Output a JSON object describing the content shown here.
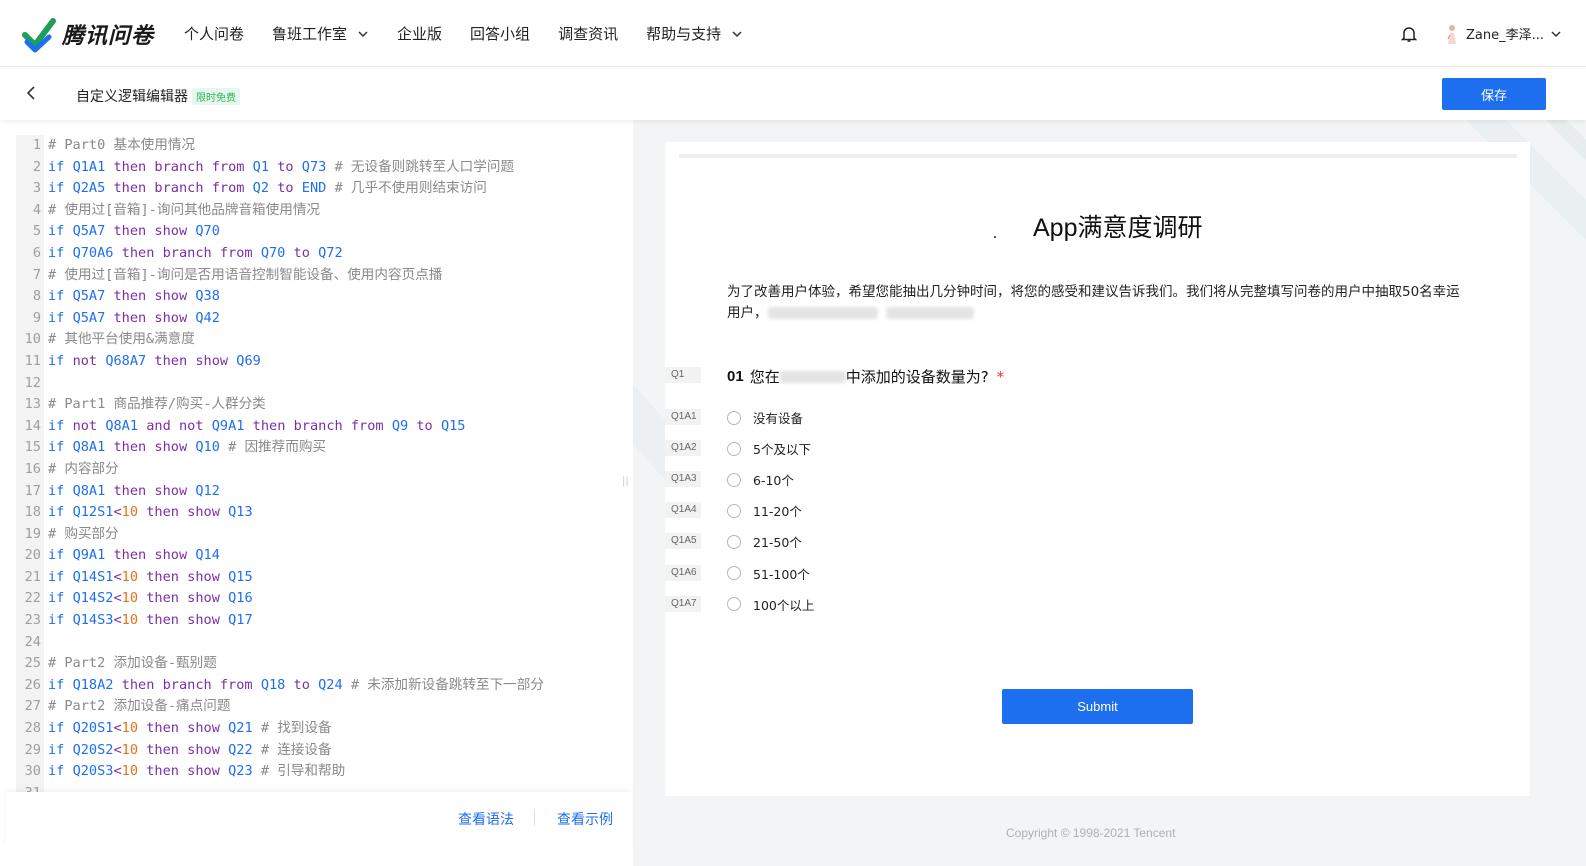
{
  "nav": {
    "brand": "腾讯问卷",
    "items": [
      "个人问卷",
      "鲁班工作室",
      "企业版",
      "回答小组",
      "调查资讯",
      "帮助与支持"
    ],
    "user": "Zane_李泽..."
  },
  "subheader": {
    "title": "自定义逻辑编辑器",
    "badge": "限时免费",
    "save_label": "保存"
  },
  "editor": {
    "lines": [
      {
        "n": "1",
        "tokens": [
          [
            "cm",
            "# Part0 基本使用情况"
          ]
        ]
      },
      {
        "n": "2",
        "tokens": [
          [
            "kw",
            "if "
          ],
          [
            "id",
            "Q1A1"
          ],
          [
            "kw2",
            " then branch from "
          ],
          [
            "id",
            "Q1"
          ],
          [
            "kw2",
            " to "
          ],
          [
            "id",
            "Q73"
          ],
          [
            "cm",
            " # 无设备则跳转至人口学问题"
          ]
        ]
      },
      {
        "n": "3",
        "tokens": [
          [
            "kw",
            "if "
          ],
          [
            "id",
            "Q2A5"
          ],
          [
            "kw2",
            " then branch from "
          ],
          [
            "id",
            "Q2"
          ],
          [
            "kw2",
            " to "
          ],
          [
            "id",
            "END"
          ],
          [
            "cm",
            " # 几乎不使用则结束访问"
          ]
        ]
      },
      {
        "n": "4",
        "tokens": [
          [
            "cm",
            "# 使用过[音箱]-询问其他品牌音箱使用情况"
          ]
        ]
      },
      {
        "n": "5",
        "tokens": [
          [
            "kw",
            "if "
          ],
          [
            "id",
            "Q5A7"
          ],
          [
            "kw2",
            " then show "
          ],
          [
            "id",
            "Q70"
          ]
        ]
      },
      {
        "n": "6",
        "tokens": [
          [
            "kw",
            "if "
          ],
          [
            "id",
            "Q70A6"
          ],
          [
            "kw2",
            " then branch from "
          ],
          [
            "id",
            "Q70"
          ],
          [
            "kw2",
            " to "
          ],
          [
            "id",
            "Q72"
          ]
        ]
      },
      {
        "n": "7",
        "tokens": [
          [
            "cm",
            "# 使用过[音箱]-询问是否用语音控制智能设备、使用内容页点播"
          ]
        ]
      },
      {
        "n": "8",
        "tokens": [
          [
            "kw",
            "if "
          ],
          [
            "id",
            "Q5A7"
          ],
          [
            "kw2",
            " then show "
          ],
          [
            "id",
            "Q38"
          ]
        ]
      },
      {
        "n": "9",
        "tokens": [
          [
            "kw",
            "if "
          ],
          [
            "id",
            "Q5A7"
          ],
          [
            "kw2",
            " then show "
          ],
          [
            "id",
            "Q42"
          ]
        ]
      },
      {
        "n": "10",
        "tokens": [
          [
            "cm",
            "# 其他平台使用&满意度"
          ]
        ]
      },
      {
        "n": "11",
        "tokens": [
          [
            "kw",
            "if "
          ],
          [
            "kw2",
            "not "
          ],
          [
            "id",
            "Q68A7"
          ],
          [
            "kw2",
            " then show "
          ],
          [
            "id",
            "Q69"
          ]
        ]
      },
      {
        "n": "12",
        "tokens": []
      },
      {
        "n": "13",
        "tokens": [
          [
            "cm",
            "# Part1 商品推荐/购买-人群分类"
          ]
        ]
      },
      {
        "n": "14",
        "tokens": [
          [
            "kw",
            "if "
          ],
          [
            "kw2",
            "not "
          ],
          [
            "id",
            "Q8A1"
          ],
          [
            "kw2",
            " and not "
          ],
          [
            "id",
            "Q9A1"
          ],
          [
            "kw2",
            " then branch from "
          ],
          [
            "id",
            "Q9"
          ],
          [
            "kw2",
            " to "
          ],
          [
            "id",
            "Q15"
          ]
        ]
      },
      {
        "n": "15",
        "tokens": [
          [
            "kw",
            "if "
          ],
          [
            "id",
            "Q8A1"
          ],
          [
            "kw2",
            " then show "
          ],
          [
            "id",
            "Q10"
          ],
          [
            "cm",
            " # 因推荐而购买"
          ]
        ]
      },
      {
        "n": "16",
        "tokens": [
          [
            "cm",
            "# 内容部分"
          ]
        ]
      },
      {
        "n": "17",
        "tokens": [
          [
            "kw",
            "if "
          ],
          [
            "id",
            "Q8A1"
          ],
          [
            "kw2",
            " then show "
          ],
          [
            "id",
            "Q12"
          ]
        ]
      },
      {
        "n": "18",
        "tokens": [
          [
            "kw",
            "if "
          ],
          [
            "id",
            "Q12S1"
          ],
          [
            "kw2",
            "<"
          ],
          [
            "num",
            "10"
          ],
          [
            "kw2",
            " then show "
          ],
          [
            "id",
            "Q13"
          ]
        ]
      },
      {
        "n": "19",
        "tokens": [
          [
            "cm",
            "# 购买部分"
          ]
        ]
      },
      {
        "n": "20",
        "tokens": [
          [
            "kw",
            "if "
          ],
          [
            "id",
            "Q9A1"
          ],
          [
            "kw2",
            " then show "
          ],
          [
            "id",
            "Q14"
          ]
        ]
      },
      {
        "n": "21",
        "tokens": [
          [
            "kw",
            "if "
          ],
          [
            "id",
            "Q14S1"
          ],
          [
            "kw2",
            "<"
          ],
          [
            "num",
            "10"
          ],
          [
            "kw2",
            " then show "
          ],
          [
            "id",
            "Q15"
          ]
        ]
      },
      {
        "n": "22",
        "tokens": [
          [
            "kw",
            "if "
          ],
          [
            "id",
            "Q14S2"
          ],
          [
            "kw2",
            "<"
          ],
          [
            "num",
            "10"
          ],
          [
            "kw2",
            " then show "
          ],
          [
            "id",
            "Q16"
          ]
        ]
      },
      {
        "n": "23",
        "tokens": [
          [
            "kw",
            "if "
          ],
          [
            "id",
            "Q14S3"
          ],
          [
            "kw2",
            "<"
          ],
          [
            "num",
            "10"
          ],
          [
            "kw2",
            " then show "
          ],
          [
            "id",
            "Q17"
          ]
        ]
      },
      {
        "n": "24",
        "tokens": []
      },
      {
        "n": "25",
        "tokens": [
          [
            "cm",
            "# Part2 添加设备-甄别题"
          ]
        ]
      },
      {
        "n": "26",
        "tokens": [
          [
            "kw",
            "if "
          ],
          [
            "id",
            "Q18A2"
          ],
          [
            "kw2",
            " then branch from "
          ],
          [
            "id",
            "Q18"
          ],
          [
            "kw2",
            " to "
          ],
          [
            "id",
            "Q24"
          ],
          [
            "cm",
            " # 未添加新设备跳转至下一部分"
          ]
        ]
      },
      {
        "n": "27",
        "tokens": [
          [
            "cm",
            "# Part2 添加设备-痛点问题"
          ]
        ]
      },
      {
        "n": "28",
        "tokens": [
          [
            "kw",
            "if "
          ],
          [
            "id",
            "Q20S1"
          ],
          [
            "kw2",
            "<"
          ],
          [
            "num",
            "10"
          ],
          [
            "kw2",
            " then show "
          ],
          [
            "id",
            "Q21"
          ],
          [
            "cm",
            " # 找到设备"
          ]
        ]
      },
      {
        "n": "29",
        "tokens": [
          [
            "kw",
            "if "
          ],
          [
            "id",
            "Q20S2"
          ],
          [
            "kw2",
            "<"
          ],
          [
            "num",
            "10"
          ],
          [
            "kw2",
            " then show "
          ],
          [
            "id",
            "Q22"
          ],
          [
            "cm",
            " # 连接设备"
          ]
        ]
      },
      {
        "n": "30",
        "tokens": [
          [
            "kw",
            "if "
          ],
          [
            "id",
            "Q20S3"
          ],
          [
            "kw2",
            "<"
          ],
          [
            "num",
            "10"
          ],
          [
            "kw2",
            " then show "
          ],
          [
            "id",
            "Q23"
          ],
          [
            "cm",
            " # 引导和帮助"
          ]
        ]
      },
      {
        "n": "31",
        "tokens": []
      }
    ],
    "footer_links": [
      "查看语法",
      "查看示例"
    ]
  },
  "preview": {
    "title": "App满意度调研",
    "intro_a": "为了改善用户体验，希望您能抽出几分钟时间，将您的感受和建议告诉我们。我们将从完整填写问卷的用户中抽取50名幸运用户，",
    "question": {
      "tag": "Q1",
      "num": "01",
      "text_a": "您在",
      "text_b": "中添加的设备数量为?",
      "required_mark": "*"
    },
    "options": [
      {
        "tag": "Q1A1",
        "label": "没有设备"
      },
      {
        "tag": "Q1A2",
        "label": "5个及以下"
      },
      {
        "tag": "Q1A3",
        "label": "6-10个"
      },
      {
        "tag": "Q1A4",
        "label": "11-20个"
      },
      {
        "tag": "Q1A5",
        "label": "21-50个"
      },
      {
        "tag": "Q1A6",
        "label": "51-100个"
      },
      {
        "tag": "Q1A7",
        "label": "100个以上"
      }
    ],
    "submit_label": "Submit",
    "copyright": "Copyright © 1998-2021 Tencent"
  },
  "colors": {
    "accent": "#1e6ff0",
    "keyword": "#7b2fa6",
    "number": "#e8701a",
    "comment": "#8a8a8a"
  }
}
